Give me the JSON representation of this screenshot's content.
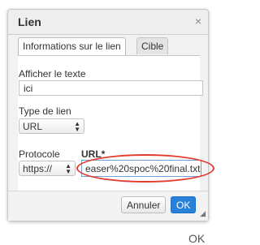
{
  "dialog": {
    "title": "Lien",
    "close": "×",
    "tabs": [
      {
        "label": "Informations sur le lien"
      },
      {
        "label": "Cible"
      }
    ]
  },
  "form": {
    "display_text_label": "Afficher le texte",
    "display_text_value": "ici",
    "link_type_label": "Type de lien",
    "link_type_value": "URL",
    "protocol_label": "Protocole",
    "protocol_value": "https://",
    "url_label": "URL*",
    "url_value": "easer%20spoc%20final.txt"
  },
  "footer": {
    "cancel_label": "Annuler",
    "ok_label": "OK"
  },
  "background_peek_label": "OK",
  "colors": {
    "accent": "#2880d8",
    "highlight": "#e23a2f"
  }
}
